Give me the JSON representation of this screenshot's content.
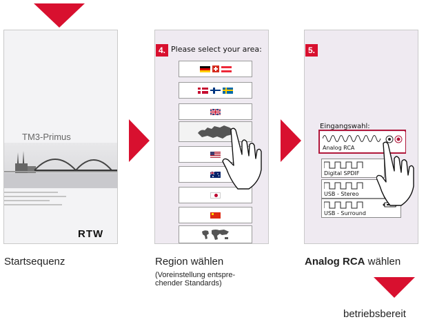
{
  "top_arrow": {
    "icon": "arrow-down-icon",
    "color": "#d8102f"
  },
  "panel1": {
    "title": "TM3-Primus",
    "logo": "RTW",
    "caption": "Startsequenz"
  },
  "panel2": {
    "step": "4.",
    "prompt": "Please select your area:",
    "buttons": [
      {
        "name": "area-europe-central",
        "flags": [
          "de-flag-icon",
          "ch-flag-icon",
          "at-flag-icon"
        ]
      },
      {
        "name": "area-scandinavia",
        "flags": [
          "dk-flag-icon",
          "fi-flag-icon",
          "se-flag-icon"
        ]
      },
      {
        "name": "area-uk",
        "flags": [
          "uk-flag-icon"
        ]
      },
      {
        "name": "area-europe-map",
        "flags": [
          "europe-map-icon"
        ]
      },
      {
        "name": "area-usa",
        "flags": [
          "us-flag-icon"
        ]
      },
      {
        "name": "area-australia",
        "flags": [
          "au-flag-icon"
        ]
      },
      {
        "name": "area-japan",
        "flags": [
          "jp-flag-icon"
        ]
      },
      {
        "name": "area-china",
        "flags": [
          "cn-flag-icon"
        ]
      },
      {
        "name": "area-world",
        "flags": [
          "world-map-icon"
        ]
      }
    ],
    "caption": "Region wählen",
    "subcaption_line1": "(Voreinstellung entspre-",
    "subcaption_line2": "chender Standards)"
  },
  "panel3": {
    "step": "5.",
    "title": "Eingangswahl:",
    "sources": [
      "Analog RCA",
      "Digital SPDIF",
      "USB - Stereo",
      "USB - Surround"
    ],
    "selected": "Analog RCA",
    "caption_bold": "Analog RCA",
    "caption_rest": " wählen"
  },
  "final": {
    "label": "betriebsbereit"
  },
  "colors": {
    "accent": "#d8102f",
    "panel_bg": "#efeaf1"
  }
}
